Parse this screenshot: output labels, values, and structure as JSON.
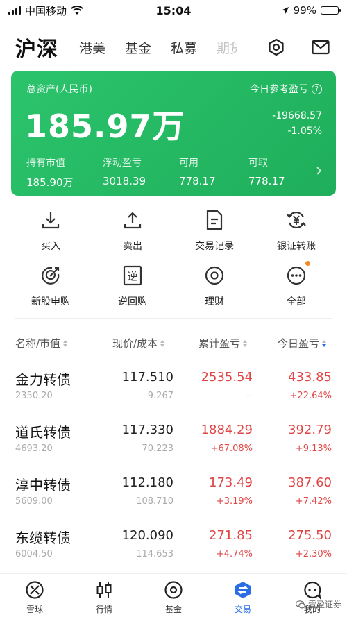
{
  "status_bar": {
    "carrier": "中国移动",
    "time": "15:04",
    "battery": "99%"
  },
  "top_nav": {
    "active": "沪深",
    "tabs": [
      "港美",
      "基金",
      "私募",
      "期货"
    ]
  },
  "asset_card": {
    "total_label": "总资产(人民币)",
    "total_value": "185.97万",
    "today_label": "今日参考盈亏",
    "today_amount": "-19668.57",
    "today_percent": "-1.05%",
    "stats": [
      {
        "label": "持有市值",
        "value": "185.90万"
      },
      {
        "label": "浮动盈亏",
        "value": "3018.39"
      },
      {
        "label": "可用",
        "value": "778.17"
      },
      {
        "label": "可取",
        "value": "778.17"
      }
    ]
  },
  "actions": {
    "row1": [
      "买入",
      "卖出",
      "交易记录",
      "银证转账"
    ],
    "row2": [
      "新股申购",
      "逆回购",
      "理财",
      "全部"
    ]
  },
  "table": {
    "headers": [
      "名称/市值",
      "现价/成本",
      "累计盈亏",
      "今日盈亏"
    ],
    "rows": [
      {
        "name": "金力转债",
        "market_value": "2350.20",
        "price": "117.510",
        "cost": "-9.267",
        "cum_pnl": "2535.54",
        "cum_pct": "--",
        "today_pnl": "433.85",
        "today_pct": "+22.64%"
      },
      {
        "name": "道氏转债",
        "market_value": "4693.20",
        "price": "117.330",
        "cost": "70.223",
        "cum_pnl": "1884.29",
        "cum_pct": "+67.08%",
        "today_pnl": "392.79",
        "today_pct": "+9.13%"
      },
      {
        "name": "淳中转债",
        "market_value": "5609.00",
        "price": "112.180",
        "cost": "108.710",
        "cum_pnl": "173.49",
        "cum_pct": "+3.19%",
        "today_pnl": "387.60",
        "today_pct": "+7.42%"
      },
      {
        "name": "东缆转债",
        "market_value": "6004.50",
        "price": "120.090",
        "cost": "114.653",
        "cum_pnl": "271.85",
        "cum_pct": "+4.74%",
        "today_pnl": "275.50",
        "today_pct": "+2.30%"
      }
    ]
  },
  "tabbar": {
    "tabs": [
      "雪球",
      "行情",
      "基金",
      "交易",
      "我的"
    ],
    "active_index": 3
  },
  "watermark": "雪盈证券",
  "colors": {
    "card_green": "#23b863",
    "loss_red": "#e04646",
    "active_blue": "#2b6de5",
    "badge_orange": "#f08a24"
  }
}
